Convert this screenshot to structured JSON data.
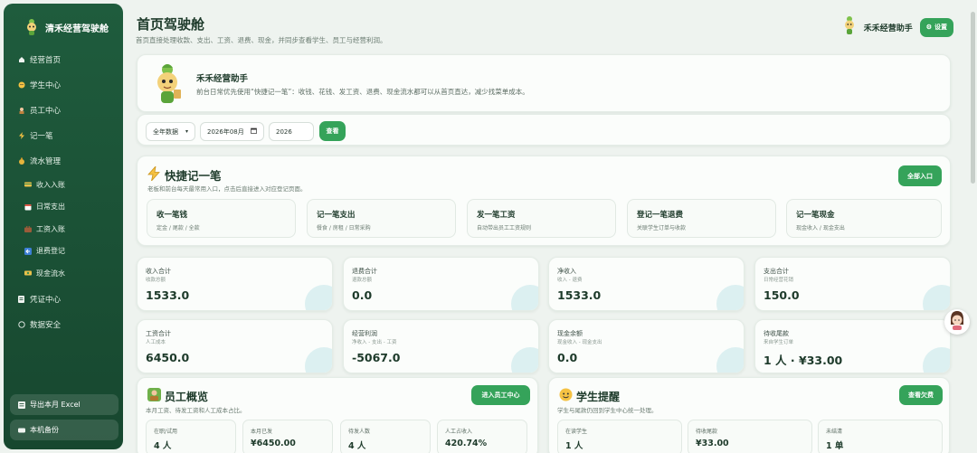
{
  "sidebar": {
    "brand": "清禾经营驾驶舱",
    "items": [
      {
        "icon": "home-icon",
        "glyph": "🏠",
        "label": "经营首页"
      },
      {
        "icon": "student-icon",
        "glyph": "●",
        "label": "学生中心"
      },
      {
        "icon": "staff-icon",
        "glyph": "▣",
        "label": "员工中心"
      },
      {
        "icon": "lightning-icon",
        "glyph": "⚡",
        "label": "记一笔"
      },
      {
        "icon": "money-bag-icon",
        "glyph": "●",
        "label": "流水管理"
      },
      {
        "icon": "cash-icon",
        "glyph": "▬",
        "label": "收入入账",
        "sub": true
      },
      {
        "icon": "calendar-icon",
        "glyph": "▤",
        "label": "日常支出",
        "sub": true
      },
      {
        "icon": "briefcase-icon",
        "glyph": "▣",
        "label": "工资入账",
        "sub": true
      },
      {
        "icon": "refund-icon",
        "glyph": "▨",
        "label": "退费登记",
        "sub": true
      },
      {
        "icon": "cash-flow-icon",
        "glyph": "▬",
        "label": "现金流水",
        "sub": true
      },
      {
        "icon": "document-icon",
        "glyph": "▐",
        "label": "凭证中心"
      },
      {
        "icon": "shield-icon",
        "glyph": "○",
        "label": "数据安全"
      }
    ],
    "export_label": "导出本月 Excel",
    "backup_label": "本机备份"
  },
  "header": {
    "title": "首页驾驶舱",
    "subtitle": "首页直接处理收款、支出、工资、退费、现金，并同步查看学生、员工与经营利润。",
    "assistant_name": "禾禾经营助手",
    "settings_label": "设置"
  },
  "hero": {
    "title": "禾禾经营助手",
    "text": "前台日常优先使用“快捷记一笔”：收钱、花钱、发工资、退费、现金流水都可以从首页直达，减少找菜单成本。"
  },
  "filters": {
    "scope": "全年数据",
    "month": "2026年08月",
    "year": "2026",
    "view_label": "查看"
  },
  "quick": {
    "title": "快捷记一笔",
    "subtitle": "老板和前台每天最常用入口，点击后直接进入对应登记页面。",
    "all_label": "全部入口",
    "items": [
      {
        "label": "收一笔钱",
        "desc": "定金 / 尾款 / 全款"
      },
      {
        "label": "记一笔支出",
        "desc": "餐食 / 房租 / 日常采购"
      },
      {
        "label": "发一笔工资",
        "desc": "自动带出员工工资规则"
      },
      {
        "label": "登记一笔退费",
        "desc": "关联学生订单与收款"
      },
      {
        "label": "记一笔现金",
        "desc": "现金收入 / 现金支出"
      }
    ]
  },
  "stats": [
    {
      "title": "收入合计",
      "sub": "收款总额",
      "value": "1533.0"
    },
    {
      "title": "退费合计",
      "sub": "退款总额",
      "value": "0.0"
    },
    {
      "title": "净收入",
      "sub": "收入 - 退费",
      "value": "1533.0"
    },
    {
      "title": "支出合计",
      "sub": "日常经营花销",
      "value": "150.0"
    },
    {
      "title": "工资合计",
      "sub": "人工成本",
      "value": "6450.0"
    },
    {
      "title": "经营利润",
      "sub": "净收入 - 支出 - 工资",
      "value": "-5067.0"
    },
    {
      "title": "现金余额",
      "sub": "现金收入 - 现金支出",
      "value": "0.0"
    },
    {
      "title": "待收尾款",
      "sub": "来自学生订单",
      "value": "1 人 · ¥33.00"
    }
  ],
  "staff": {
    "title": "员工概览",
    "subtitle": "本月工资、待发工资和人工成本占比。",
    "button": "进入员工中心",
    "metrics": [
      {
        "label": "在职/试用",
        "value": "4 人"
      },
      {
        "label": "本月已发",
        "value": "¥6450.00"
      },
      {
        "label": "待发人数",
        "value": "4 人"
      },
      {
        "label": "人工占收入",
        "value": "420.74%"
      }
    ]
  },
  "students": {
    "title": "学生提醒",
    "subtitle": "学生与尾款仍回到学生中心统一处理。",
    "button": "查看欠费",
    "metrics": [
      {
        "label": "在读学生",
        "value": "1 人"
      },
      {
        "label": "待收尾款",
        "value": "¥33.00"
      },
      {
        "label": "未结清",
        "value": "1 单"
      }
    ]
  }
}
